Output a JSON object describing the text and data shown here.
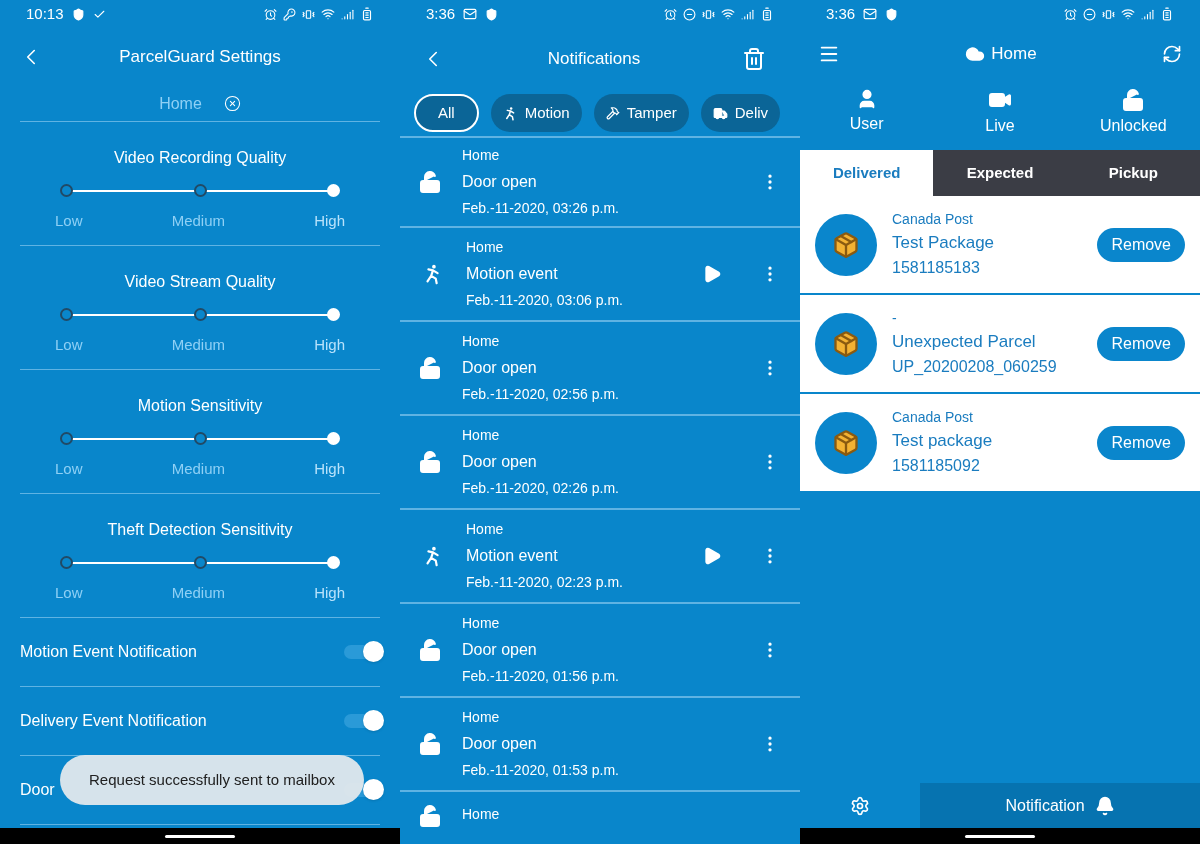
{
  "settings_screen": {
    "status_bar": {
      "time": "10:13"
    },
    "title": "ParcelGuard Settings",
    "location_field": {
      "value": "Home"
    },
    "sliders": [
      {
        "title": "Video Recording Quality",
        "options": [
          {
            "label": "Low",
            "selected": false
          },
          {
            "label": "Medium",
            "selected": false
          },
          {
            "label": "High",
            "selected": true
          }
        ]
      },
      {
        "title": "Video Stream Quality",
        "options": [
          {
            "label": "Low",
            "selected": false
          },
          {
            "label": "Medium",
            "selected": false
          },
          {
            "label": "High",
            "selected": true
          }
        ]
      },
      {
        "title": "Motion Sensitivity",
        "options": [
          {
            "label": "Low",
            "selected": false
          },
          {
            "label": "Medium",
            "selected": false
          },
          {
            "label": "High",
            "selected": true
          }
        ]
      },
      {
        "title": "Theft Detection Sensitivity",
        "options": [
          {
            "label": "Low",
            "selected": false
          },
          {
            "label": "Medium",
            "selected": false
          },
          {
            "label": "High",
            "selected": true
          }
        ]
      }
    ],
    "toggles": [
      {
        "label": "Motion Event Notification",
        "on": true
      },
      {
        "label": "Delivery Event Notification",
        "on": true
      },
      {
        "label": "Door",
        "on": true
      }
    ],
    "toast": "Request successfully sent to mailbox"
  },
  "notifications_screen": {
    "status_bar": {
      "time": "3:36"
    },
    "title": "Notifications",
    "filters": [
      {
        "kind": "all",
        "label": "All",
        "selected": true
      },
      {
        "kind": "motion",
        "label": "Motion",
        "selected": false
      },
      {
        "kind": "tamper",
        "label": "Tamper",
        "selected": false
      },
      {
        "kind": "delivery",
        "label": "Deliv",
        "selected": false
      }
    ],
    "events": [
      {
        "kind": "door",
        "location": "Home",
        "title": "Door open",
        "time": "Feb.-11-2020, 03:26 p.m."
      },
      {
        "kind": "motion",
        "location": "Home",
        "title": "Motion event",
        "time": "Feb.-11-2020, 03:06 p.m."
      },
      {
        "kind": "door",
        "location": "Home",
        "title": "Door open",
        "time": "Feb.-11-2020, 02:56 p.m."
      },
      {
        "kind": "door",
        "location": "Home",
        "title": "Door open",
        "time": "Feb.-11-2020, 02:26 p.m."
      },
      {
        "kind": "motion",
        "location": "Home",
        "title": "Motion event",
        "time": "Feb.-11-2020, 02:23 p.m."
      },
      {
        "kind": "door",
        "location": "Home",
        "title": "Door open",
        "time": "Feb.-11-2020, 01:56 p.m."
      },
      {
        "kind": "door",
        "location": "Home",
        "title": "Door open",
        "time": "Feb.-11-2020, 01:53 p.m."
      },
      {
        "kind": "door",
        "location": "Home"
      }
    ]
  },
  "home_screen": {
    "status_bar": {
      "time": "3:36"
    },
    "title": "Home",
    "nav": [
      {
        "kind": "user",
        "label": "User"
      },
      {
        "kind": "live",
        "label": "Live"
      },
      {
        "kind": "lock",
        "label": "Unlocked"
      }
    ],
    "tabs": [
      {
        "label": "Delivered",
        "selected": true
      },
      {
        "label": "Expected",
        "selected": false
      },
      {
        "label": "Pickup",
        "selected": false
      }
    ],
    "packages": [
      {
        "carrier": "Canada Post",
        "name": "Test Package",
        "tracking": "1581185183",
        "action": "Remove"
      },
      {
        "carrier": "-",
        "name": "Unexpected Parcel",
        "tracking": "UP_20200208_060259",
        "action": "Remove"
      },
      {
        "carrier": "Canada Post",
        "name": "Test package",
        "tracking": "1581185092",
        "action": "Remove"
      }
    ],
    "bottom_nav": [
      {
        "kind": "settings",
        "selected": false
      },
      {
        "kind": "notification",
        "label": "Notification",
        "selected": true
      }
    ]
  }
}
